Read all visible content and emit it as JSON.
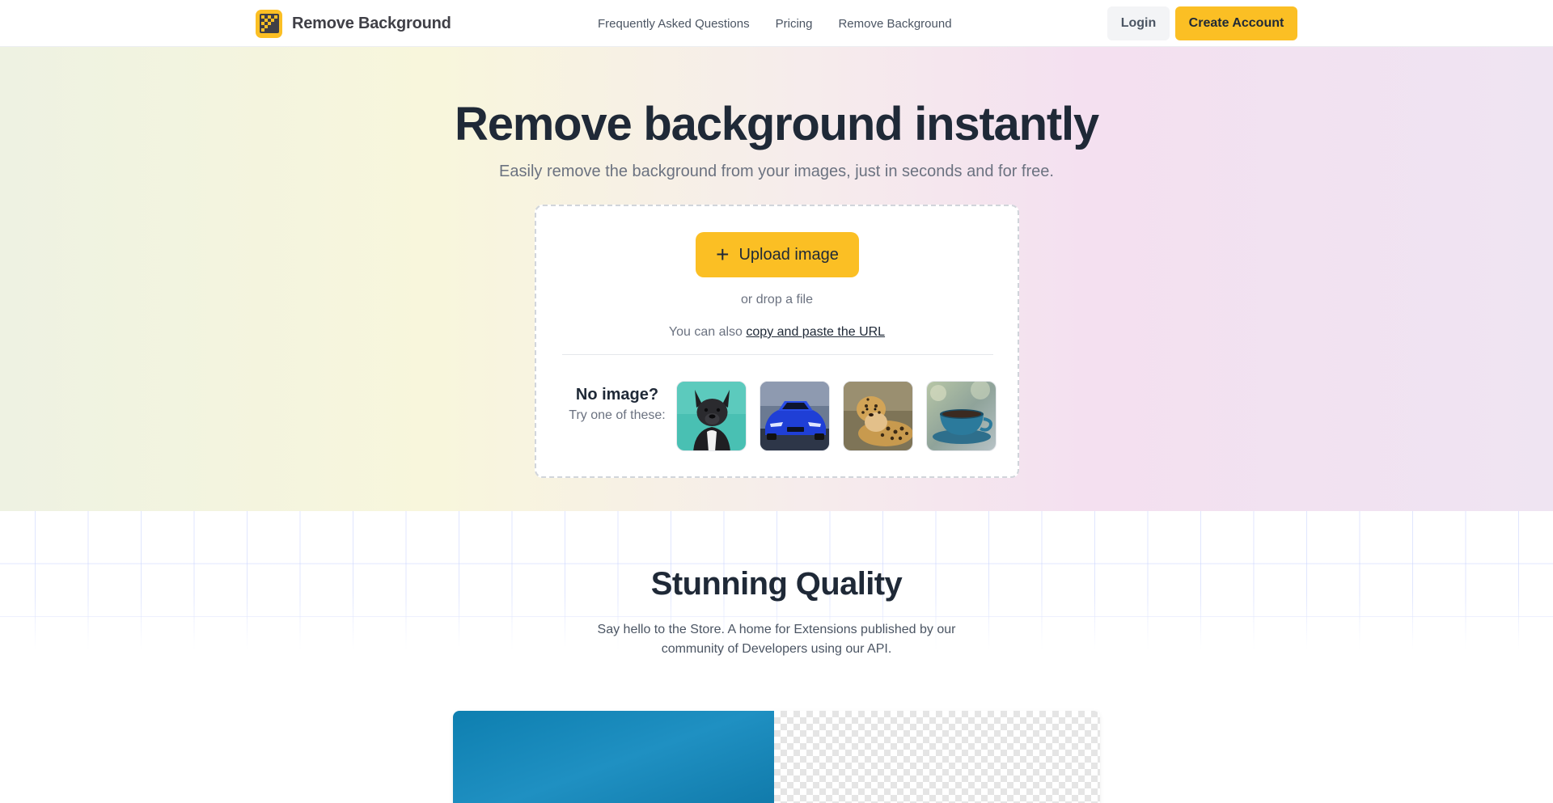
{
  "colors": {
    "accent": "#fbbf24",
    "heading": "#1f2937",
    "muted": "#6b7280"
  },
  "navbar": {
    "brand_name": "Remove Background",
    "logo_icon": "checkerboard-logo-icon",
    "links": [
      {
        "label": "Frequently Asked Questions"
      },
      {
        "label": "Pricing"
      },
      {
        "label": "Remove Background"
      }
    ],
    "login_label": "Login",
    "create_account_label": "Create Account"
  },
  "hero": {
    "title": "Remove background instantly",
    "subtitle": "Easily remove the background from your images, just in seconds and for free.",
    "upload": {
      "button_label": "Upload image",
      "button_icon": "plus-icon",
      "drop_text": "or drop a file",
      "url_prefix": "You can also",
      "url_link": "copy and paste the URL"
    },
    "samples": {
      "title": "No image?",
      "subtitle": "Try one of these:",
      "items": [
        {
          "icon": "dog-thumbnail-icon"
        },
        {
          "icon": "car-thumbnail-icon"
        },
        {
          "icon": "leopard-thumbnail-icon"
        },
        {
          "icon": "cup-thumbnail-icon"
        }
      ]
    }
  },
  "quality": {
    "title": "Stunning Quality",
    "subtitle": "Say hello to the Store. A home for Extensions published by our community of Developers using our API."
  }
}
